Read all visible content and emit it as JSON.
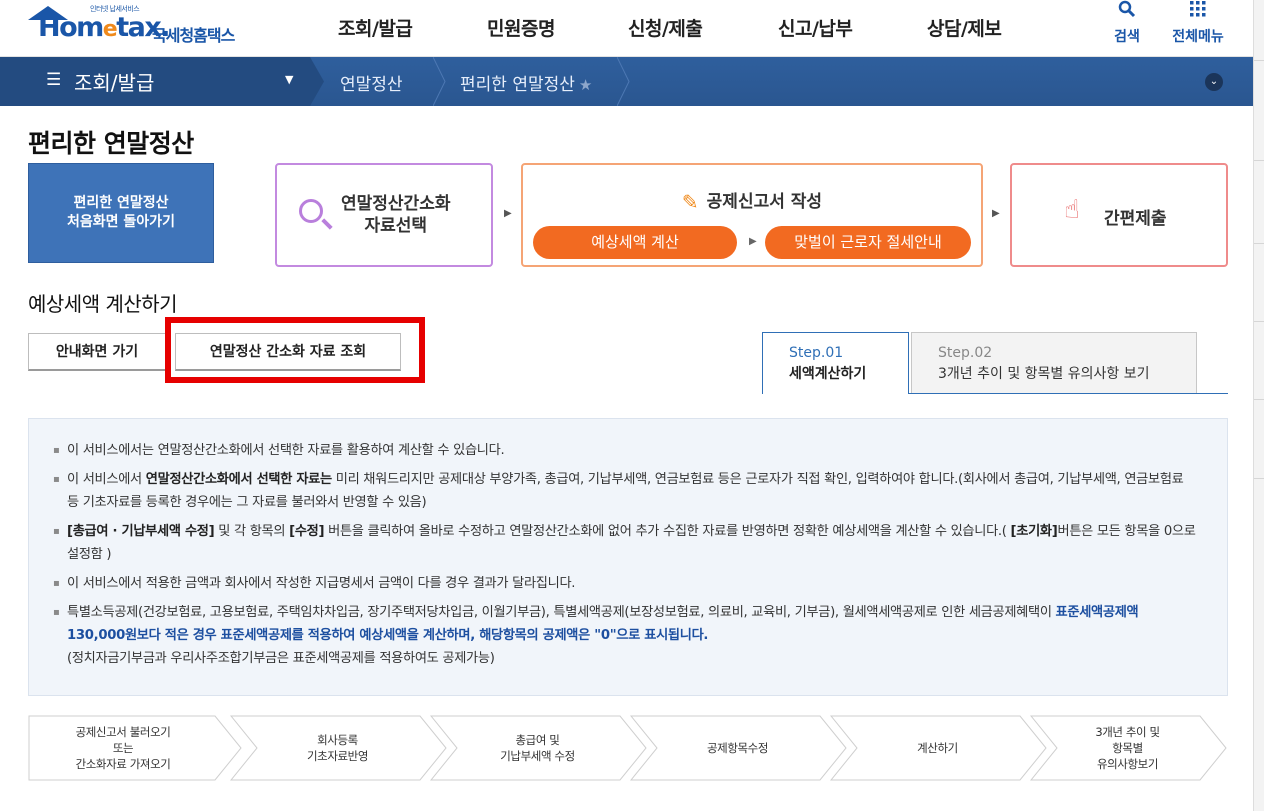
{
  "header": {
    "logo_tagline": "인터넷 납세서비스",
    "logo_brand_a": "Hom",
    "logo_brand_e": "e",
    "logo_brand_b": "tax.",
    "logo_korean": "국세청홈택스",
    "gnb": [
      "조회/발급",
      "민원증명",
      "신청/제출",
      "신고/납부",
      "상담/제보"
    ],
    "search_label": "검색",
    "allmenu_label": "전체메뉴"
  },
  "locbar": {
    "current_menu": "조회/발급",
    "crumbs": [
      "연말정산",
      "편리한 연말정산"
    ]
  },
  "page": {
    "title": "편리한 연말정산",
    "home_button": [
      "편리한 연말정산",
      "처음화면 돌아가기"
    ],
    "flow1": [
      "연말정산간소화",
      "자료선택"
    ],
    "flow2_title": "공제신고서 작성",
    "flow2_pill1": "예상세액 계산",
    "flow2_pill2": "맞벌이 근로자 절세안내",
    "flow3": "간편제출"
  },
  "section": {
    "title": "예상세액 계산하기",
    "btn_guide": "안내화면 가기",
    "btn_lookup": "연말정산 간소화 자료 조회",
    "step1_num": "Step.01",
    "step1_title": "세액계산하기",
    "step2_num": "Step.02",
    "step2_title": "3개년 추이 및 항목별 유의사항 보기"
  },
  "notice": {
    "l1": "이 서비스에서는 연말정산간소화에서 선택한 자료를 활용하여 계산할 수 있습니다.",
    "l2_a": "이 서비스에서 ",
    "l2_b": "연말정산간소화에서 선택한 자료는",
    "l2_c": " 미리 채워드리지만 공제대상 부양가족, 총급여, 기납부세액, 연금보험료 등은 근로자가 직접 확인, 입력하여야 합니다.(회사에서 총급여, 기납부세액, 연금보험료 등 기초자료를 등록한 경우에는 그 자료를 불러와서 반영할 수 있음)",
    "l3_a": "[총급여 · 기납부세액 수정]",
    "l3_b": " 및 각 항목의 ",
    "l3_c": "[수정]",
    "l3_d": " 버튼을 클릭하여 올바로 수정하고 연말정산간소화에 없어 추가 수집한 자료를 반영하면 정확한 예상세액을 계산할 수 있습니다.( ",
    "l3_e": "[초기화]",
    "l3_f": "버튼은 모든 항목을 0으로 설정함 )",
    "l4": "이 서비스에서 적용한 금액과 회사에서 작성한 지급명세서 금액이 다를 경우 결과가 달라집니다.",
    "l5_a": "특별소득공제(건강보험료, 고용보험료, 주택임차차입금, 장기주택저당차입금, 이월기부금), 특별세액공제(보장성보험료, 의료비, 교육비, 기부금), 월세액세액공제로 인한 세금공제혜택이 ",
    "l5_b": "표준세액공제액 130,000원보다 적은 경우 표준세액공제를 적용하여 예상세액을 계산하며, 해당항목의 공제액은 \"0\"으로 표시됩니다.",
    "l5_c": "(정치자금기부금과 우리사주조합기부금은 표준세액공제를 적용하여도 공제가능)"
  },
  "process": [
    [
      "공제신고서 불러오기",
      "또는",
      "간소화자료 가져오기"
    ],
    [
      "회사등록",
      "기초자료반영"
    ],
    [
      "총급여 및",
      "기납부세액 수정"
    ],
    [
      "공제항목수정"
    ],
    [
      "계산하기"
    ],
    [
      "3개년 추이 및",
      "항목별",
      "유의사항보기"
    ]
  ],
  "colors": {
    "brand_blue": "#1a56a8",
    "accent_orange": "#f26a21",
    "highlight_red": "#e60000",
    "locbar_blue": "#2a5690"
  }
}
